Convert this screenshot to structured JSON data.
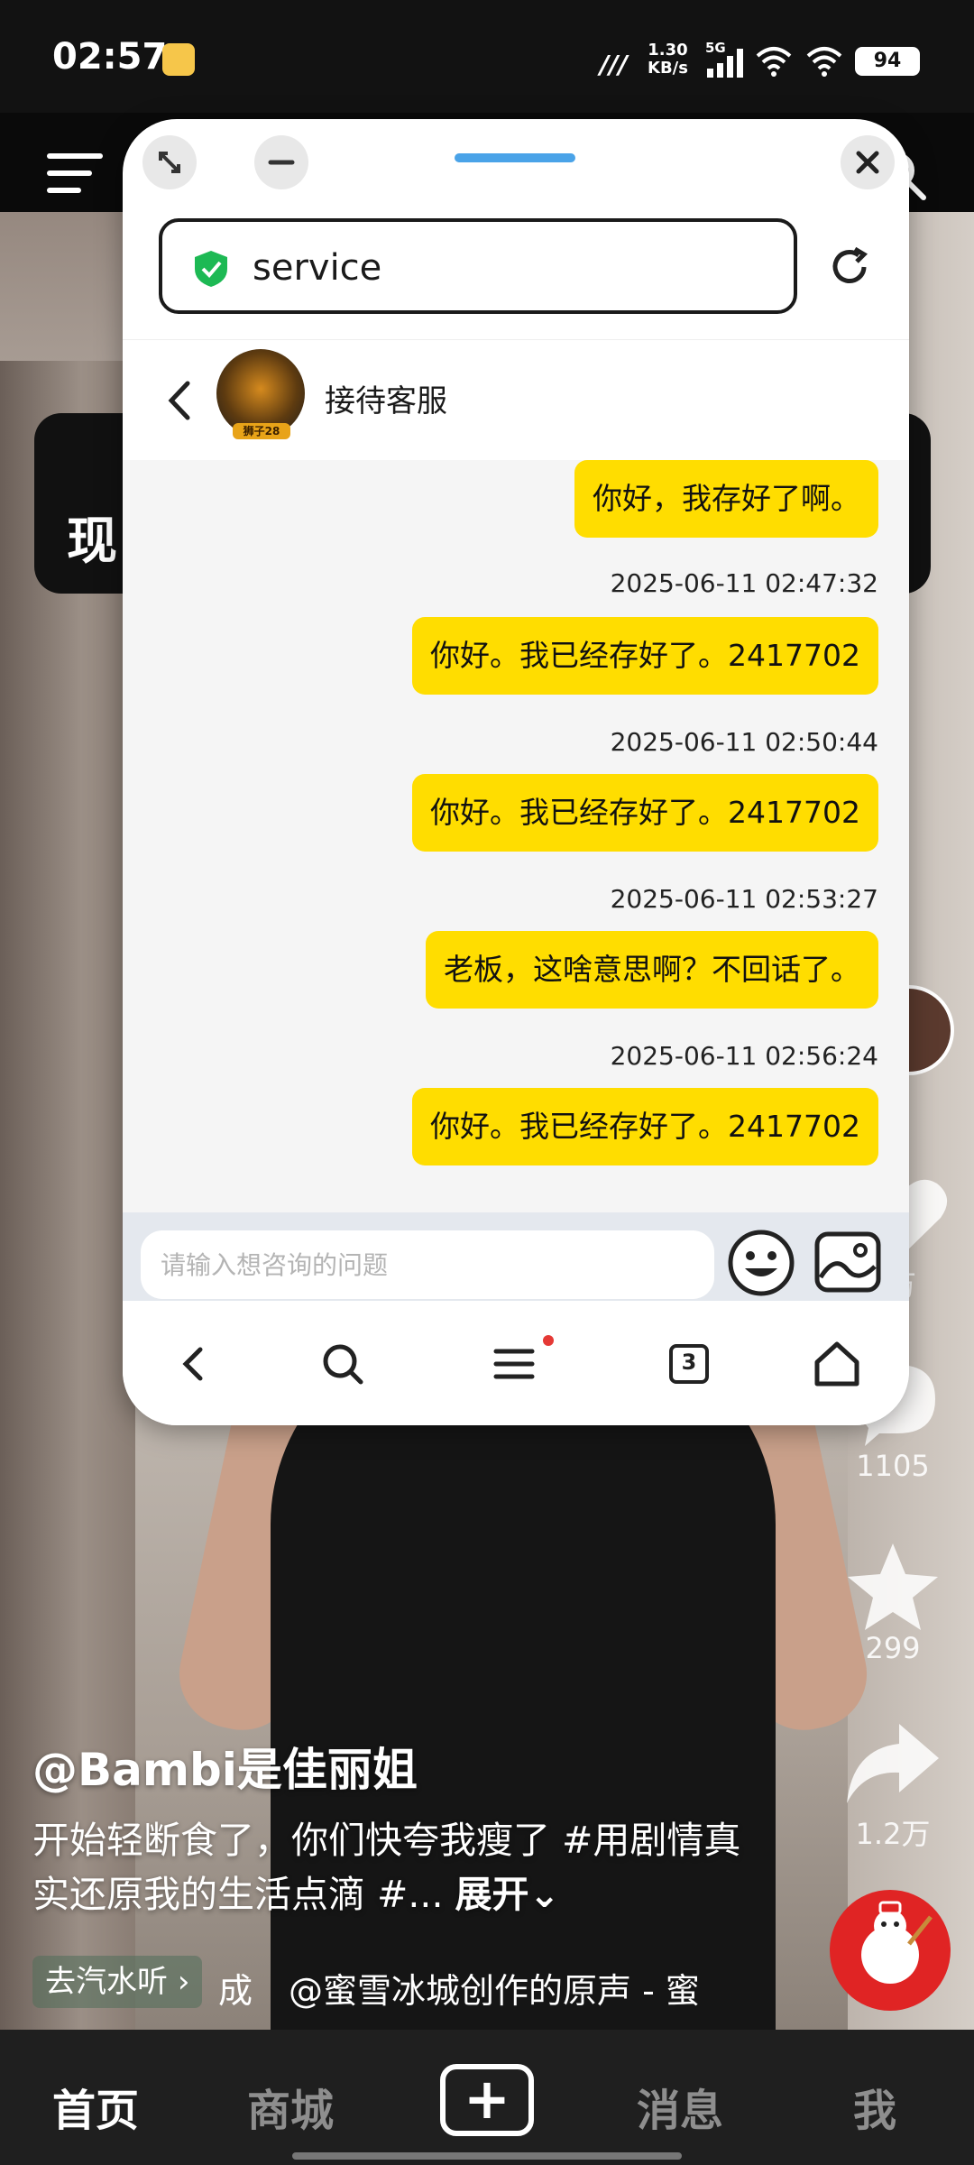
{
  "status_bar": {
    "time": "02:57",
    "net_speed_value": "1.30",
    "net_speed_unit": "KB/s",
    "network_type": "5G",
    "battery": "94"
  },
  "background_app": {
    "card_text": "现",
    "rail": {
      "like_count": "万",
      "comment_count": "1105",
      "favorite_count": "299",
      "share_count": "1.2万"
    },
    "caption": {
      "author": "@Bambi是佳丽姐",
      "text": "开始轻断食了，你们快夸我瘦了 #用剧情真实还原我的生活点滴 #... ",
      "expand_label": "展开"
    },
    "music": {
      "chip_label": "去汽水听",
      "prefix": "成",
      "text": "@蜜雪冰城创作的原声 - 蜜"
    },
    "bottom_nav": {
      "home": "首页",
      "mall": "商城",
      "add": "+",
      "messages": "消息",
      "me": "我"
    }
  },
  "floating_window": {
    "url": "service",
    "chat": {
      "title": "接待客服",
      "avatar_badge": "狮子28",
      "messages": [
        {
          "time": "",
          "text": "你好，我存好了啊。"
        },
        {
          "time": "2025-06-11 02:47:32",
          "text": "你好。我已经存好了。2417702"
        },
        {
          "time": "2025-06-11 02:50:44",
          "text": "你好。我已经存好了。2417702"
        },
        {
          "time": "2025-06-11 02:53:27",
          "text": "老板，这啥意思啊？不回话了。"
        },
        {
          "time": "2025-06-11 02:56:24",
          "text": "你好。我已经存好了。2417702"
        }
      ],
      "input_placeholder": "请输入想咨询的问题"
    },
    "browser_nav": {
      "tab_count": "3"
    }
  },
  "colors": {
    "bubble": "#ffdd00",
    "drag_handle": "#4aa3e8",
    "shield": "#1db954",
    "notification_dot": "#e53935"
  }
}
